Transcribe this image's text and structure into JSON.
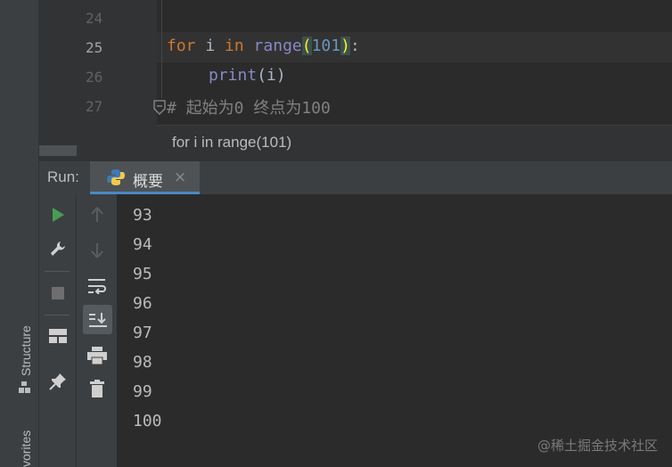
{
  "side_strip": {
    "structure_label": "Structure",
    "favorites_label": "vorites"
  },
  "editor": {
    "lines": [
      {
        "number": "24",
        "code": ""
      },
      {
        "number": "25",
        "code": "for i in range(101):"
      },
      {
        "number": "26",
        "code": "    print(i)"
      },
      {
        "number": "27",
        "code": "# 起始为0 终点为100"
      }
    ],
    "code_tokens": {
      "kw_for": "for",
      "var_i": " i ",
      "kw_in": "in",
      "fn_range": " range",
      "paren_open": "(",
      "num_101": "101",
      "paren_close": ")",
      "colon": ":",
      "fn_print": "print",
      "print_args": "(i)",
      "comment": "# 起始为0 终点为100"
    },
    "breadcrumb": "for i in range(101)"
  },
  "run_panel": {
    "label": "Run:",
    "tab_label": "概要",
    "tab_close": "×",
    "output": [
      "93",
      "94",
      "95",
      "96",
      "97",
      "98",
      "99",
      "100"
    ]
  },
  "watermark": "@稀土掘金技术社区",
  "colors": {
    "accent": "#4a88c7",
    "run_green": "#499c54",
    "keyword": "#cc7832",
    "builtin": "#8888c6",
    "number": "#6897bb"
  }
}
